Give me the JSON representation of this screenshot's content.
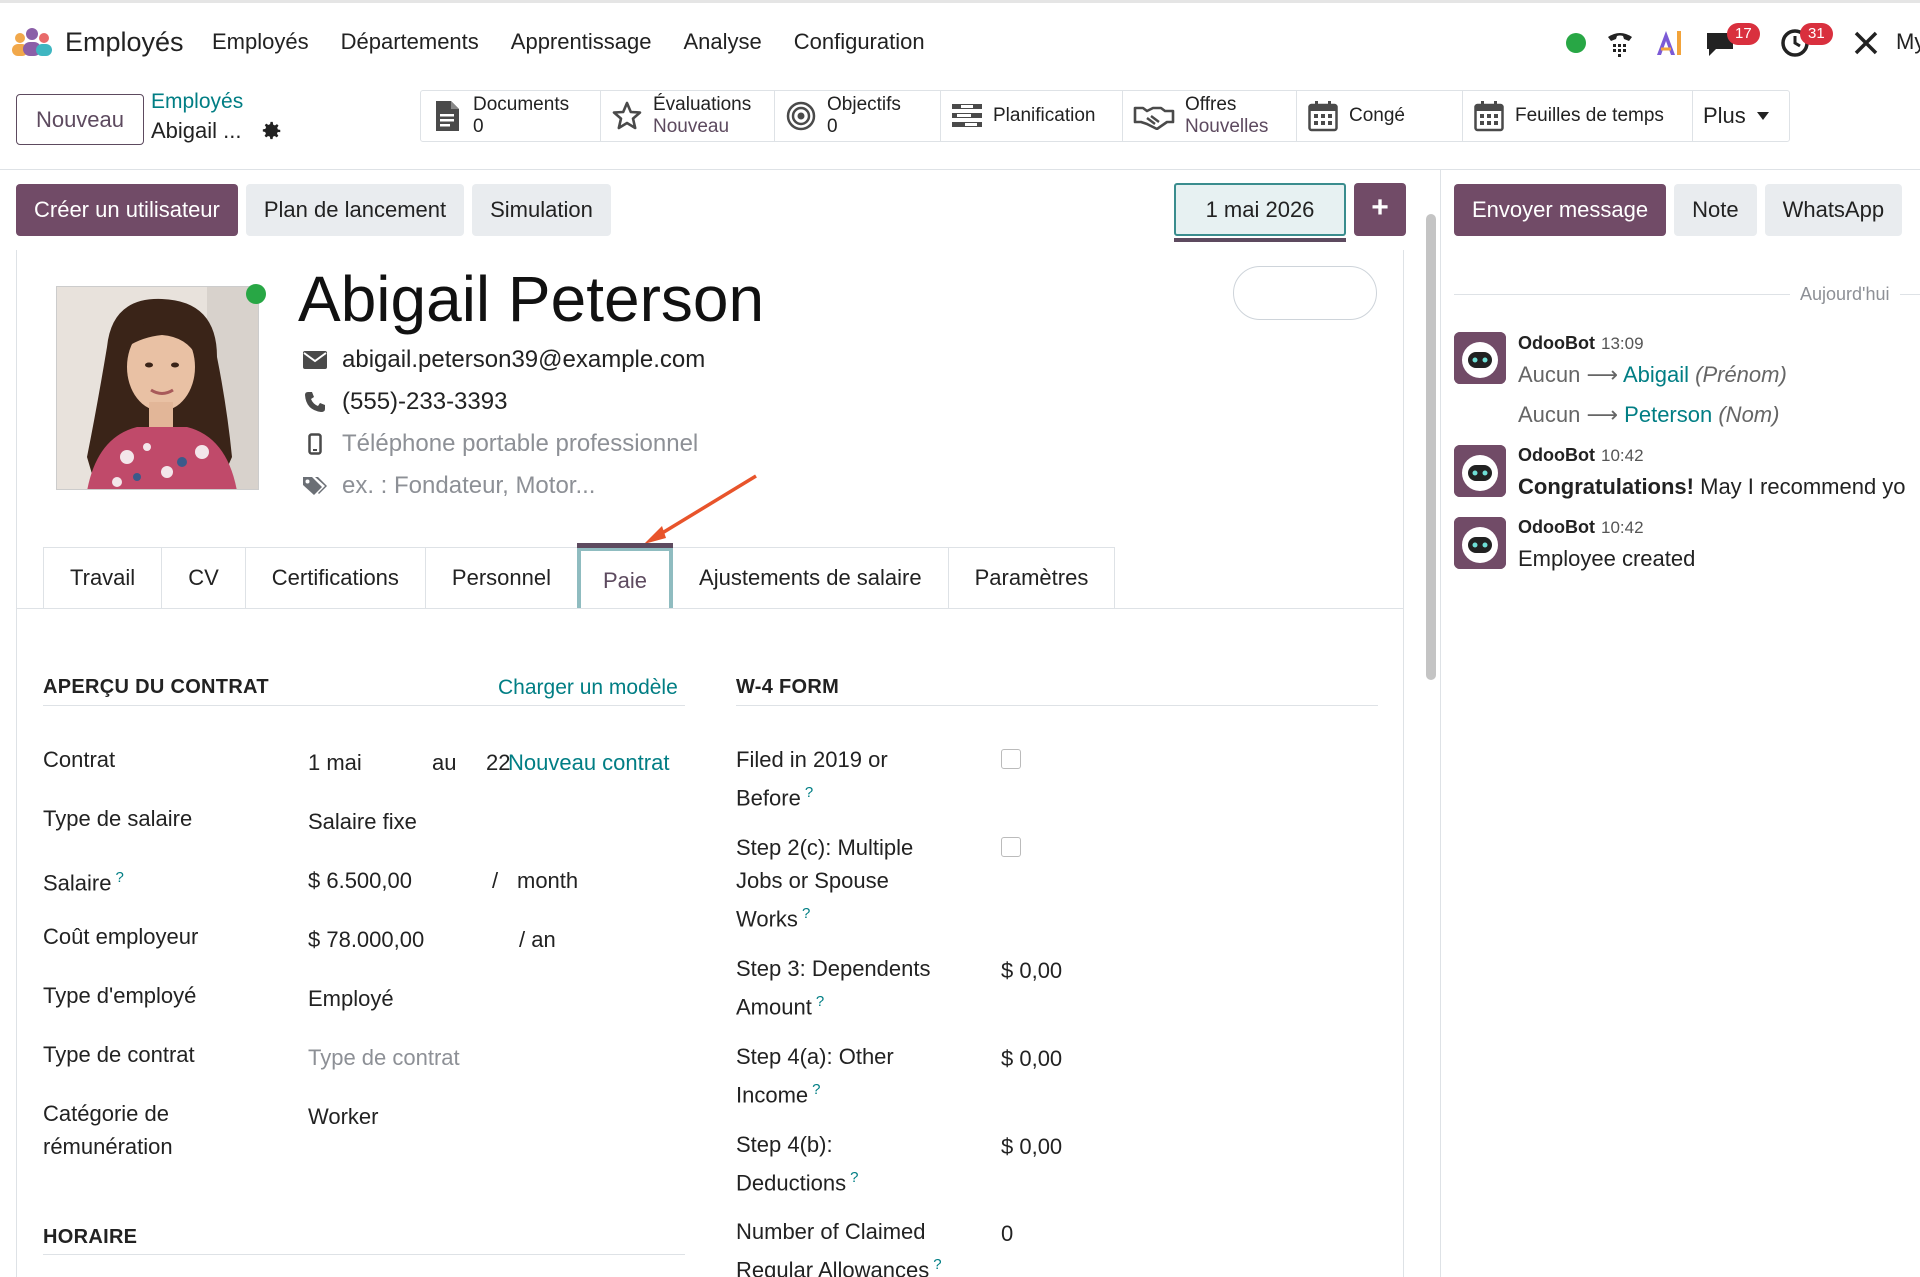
{
  "topnav": {
    "app_name": "Employés",
    "menu": [
      "Employés",
      "Départements",
      "Apprentissage",
      "Analyse",
      "Configuration"
    ],
    "chat_badge": "17",
    "activity_badge": "31",
    "company_short": "My",
    "ai_label": "AI"
  },
  "control": {
    "new_label": "Nouveau",
    "breadcrumb_parent": "Employés",
    "breadcrumb_current": "Abigail ..."
  },
  "smart_buttons": [
    {
      "label": "Documents",
      "value": "0",
      "icon": "document-icon"
    },
    {
      "label": "Évaluations",
      "value": "Nouveau",
      "icon": "star-icon"
    },
    {
      "label": "Objectifs",
      "value": "0",
      "icon": "target-icon"
    },
    {
      "label": "Planification",
      "value": "",
      "icon": "planning-icon"
    },
    {
      "label": "Offres",
      "value": "Nouvelles",
      "icon": "handshake-icon"
    },
    {
      "label": "Congé",
      "value": "",
      "icon": "calendar-icon"
    },
    {
      "label": "Feuilles de temps",
      "value": "",
      "icon": "calendar-icon"
    },
    {
      "label": "Plus",
      "value": "",
      "icon": "caret-down-icon"
    }
  ],
  "actions": {
    "create_user": "Créer un utilisateur",
    "launch_plan": "Plan de lancement",
    "simulation": "Simulation",
    "date": "1 mai 2026",
    "plus": "+"
  },
  "employee": {
    "name": "Abigail Peterson",
    "email": "abigail.peterson39@example.com",
    "phone": "(555)-233-3393",
    "mobile_placeholder": "Téléphone portable professionnel",
    "tags_placeholder": "ex. : Fondateur, Motor..."
  },
  "tabs": [
    "Travail",
    "CV",
    "Certifications",
    "Personnel",
    "Paie",
    "Ajustements de salaire",
    "Paramètres"
  ],
  "active_tab": "Paie",
  "contract": {
    "title": "APERÇU DU CONTRAT",
    "load_template": "Charger un modèle",
    "rows": [
      {
        "label": "Contrat",
        "value": "1 mai"
      },
      {
        "label": "Type de salaire",
        "value": "Salaire fixe"
      },
      {
        "label": "Salaire",
        "value": "$ 6.500,00"
      },
      {
        "label": "Coût employeur",
        "value": "$ 78.000,00"
      },
      {
        "label": "Type d'employé",
        "value": "Employé"
      },
      {
        "label": "Type de contrat",
        "value": "Type de contrat"
      },
      {
        "label": "Catégorie de rémunération",
        "value": "Worker"
      }
    ],
    "contract_to": "au",
    "contract_end_partial": "22",
    "new_contract": "Nouveau contrat",
    "salary_sep": "/",
    "salary_period": "month",
    "cost_period": "/ an",
    "schedule_title": "HORAIRE"
  },
  "w4": {
    "title": "W-4 FORM",
    "rows": [
      {
        "label": "Filed in 2019 or Before",
        "value": ""
      },
      {
        "label": "Step 2(c): Multiple Jobs or Spouse Works",
        "value": ""
      },
      {
        "label": "Step 3: Dependents Amount",
        "value": "$ 0,00"
      },
      {
        "label": "Step 4(a): Other Income",
        "value": "$ 0,00"
      },
      {
        "label": "Step 4(b): Deductions",
        "value": "$ 0,00"
      },
      {
        "label": "Number of Claimed Regular Allowances",
        "value": "0"
      }
    ]
  },
  "chatter": {
    "send_message": "Envoyer message",
    "note": "Note",
    "whatsapp": "WhatsApp",
    "today": "Aujourd'hui",
    "messages": [
      {
        "author": "OdooBot",
        "time": "13:09"
      },
      {
        "author": "OdooBot",
        "time": "10:42"
      },
      {
        "author": "OdooBot",
        "time": "10:42"
      }
    ],
    "track_none": "Aucun",
    "track1_new": "Abigail",
    "track1_field": "(Prénom)",
    "track2_new": "Peterson",
    "track2_field": "(Nom)",
    "congrats_bold": "Congratulations!",
    "congrats_rest": "May I recommend yo",
    "employee_created": "Employee created"
  },
  "colors": {
    "primary": "#714b67",
    "teal": "#017e84",
    "online": "#28a745",
    "badge": "#d9303e",
    "arrow": "#e8542b"
  }
}
